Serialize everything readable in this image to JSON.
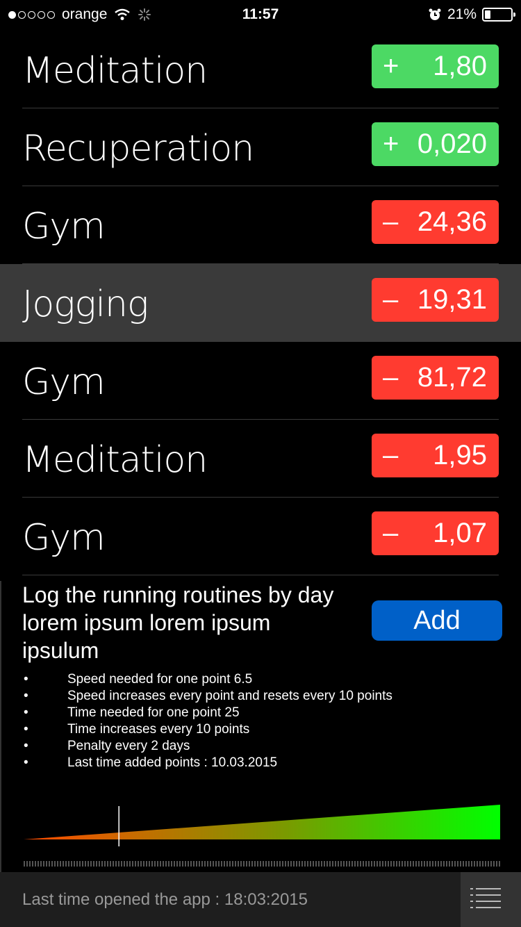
{
  "status_bar": {
    "carrier": "orange",
    "time": "11:57",
    "battery": "21%",
    "battery_level": 0.21
  },
  "items": [
    {
      "name": "Meditation",
      "sign": "+",
      "value": "1,80",
      "type": "positive"
    },
    {
      "name": "Recuperation",
      "sign": "+",
      "value": "0,020",
      "type": "positive"
    },
    {
      "name": "Gym",
      "sign": "–",
      "value": "24,36",
      "type": "negative"
    },
    {
      "name": "Jogging",
      "sign": "–",
      "value": "19,31",
      "type": "negative",
      "selected": true
    },
    {
      "name": "Gym",
      "sign": "–",
      "value": "81,72",
      "type": "negative"
    },
    {
      "name": "Meditation",
      "sign": "–",
      "value": "1,95",
      "type": "negative"
    },
    {
      "name": "Gym",
      "sign": "–",
      "value": "1,07",
      "type": "negative"
    }
  ],
  "detail": {
    "description": "Log the running routines by day lorem ipsum lorem ipsum ipsulum",
    "add_label": "Add",
    "bullets": [
      "Speed needed for one point 6.5",
      "Speed increases every point and resets every 10 points",
      "Time needed for one point 25",
      "Time increases every 10 points",
      "Penalty every 2 days",
      "Last time added points : 10.03.2015"
    ],
    "progress_marker": 0.2
  },
  "footer": {
    "last_opened": "Last time opened the app : 18:03:2015"
  },
  "colors": {
    "positive": "#4cd964",
    "negative": "#ff3b30",
    "accent": "#0060c8"
  },
  "icons": {
    "wifi": "wifi-icon",
    "activity": "activity-spinner-icon",
    "alarm": "alarm-icon",
    "menu": "list-menu-icon"
  }
}
